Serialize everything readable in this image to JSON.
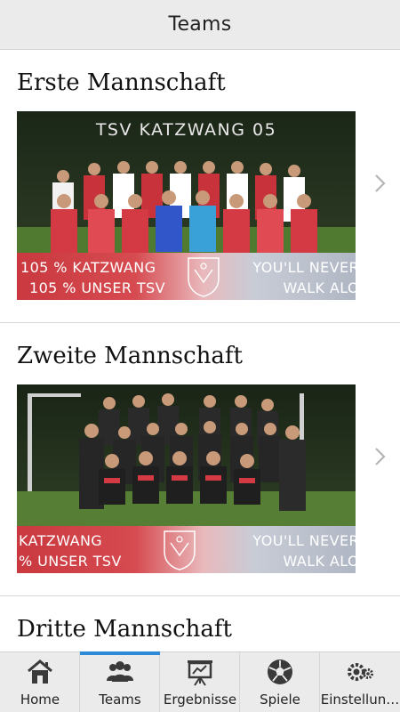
{
  "header": {
    "title": "Teams"
  },
  "teams": [
    {
      "name": "Erste Mannschaft",
      "photo_title": "TSV KATZWANG 05",
      "banner_left_line1": "105 % KATZWANG",
      "banner_left_line2": "105 % UNSER TSV",
      "banner_right_line1": "YOU'LL NEVER",
      "banner_right_line2": "WALK ALO"
    },
    {
      "name": "Zweite Mannschaft",
      "banner_left_line1": "KATZWANG",
      "banner_left_line2": "% UNSER TSV",
      "banner_right_line1": "YOU'LL NEVER",
      "banner_right_line2": "WALK ALO"
    },
    {
      "name": "Dritte Mannschaft"
    }
  ],
  "bottom_nav": {
    "items": [
      {
        "label": "Home",
        "icon": "house-icon"
      },
      {
        "label": "Teams",
        "icon": "people-icon",
        "active": true
      },
      {
        "label": "Ergebnisse",
        "icon": "presentation-board-icon"
      },
      {
        "label": "Spiele",
        "icon": "soccer-ball-icon"
      },
      {
        "label": "Einstellun…",
        "icon": "gears-icon"
      }
    ]
  },
  "colors": {
    "accent": "#2e8ad6",
    "header_bg": "#ebebeb",
    "banner_red": "#c9393f"
  }
}
